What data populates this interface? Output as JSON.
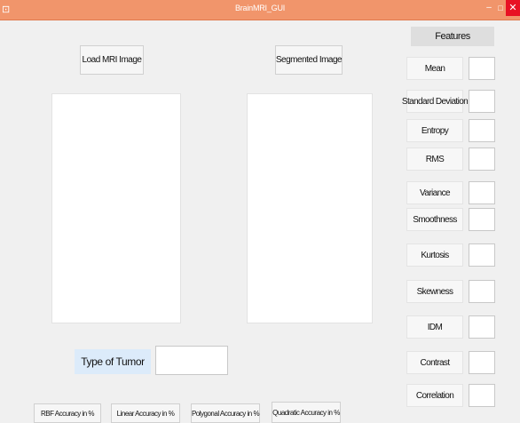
{
  "window": {
    "title": "BrainMRI_GUI"
  },
  "buttons": {
    "load": "Load MRI Image",
    "segmented": "Segmented Image"
  },
  "features": {
    "header": "Features",
    "items": [
      "Mean",
      "Standard Deviation",
      "Entropy",
      "RMS",
      "Variance",
      "Smoothness",
      "Kurtosis",
      "Skewness",
      "IDM",
      "Contrast",
      "Correlation"
    ]
  },
  "tumor": {
    "label": "Type of Tumor",
    "value": ""
  },
  "accuracy": {
    "rbf": "RBF Accuracy in %",
    "linear": "Linear Accuracy in %",
    "polygonal": "Polygonal Accuracy in %",
    "quadratic": "Quadratic Accuracy in %"
  },
  "colors": {
    "titlebar": "#f1956b",
    "close": "#e81123",
    "tumor_label_bg": "#dcebfa",
    "background": "#f0f0f0"
  }
}
